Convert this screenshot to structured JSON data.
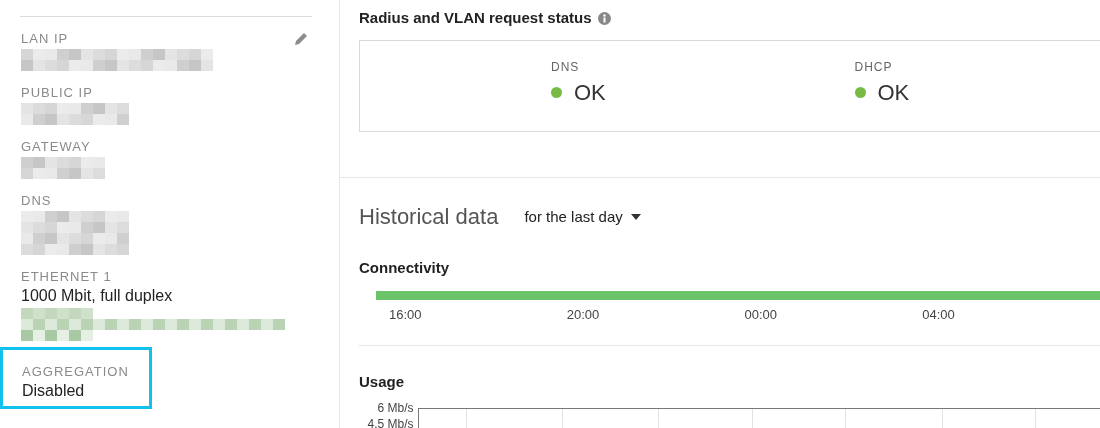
{
  "details": [
    {
      "label": "LAN IP",
      "editable": true
    },
    {
      "label": "PUBLIC IP"
    },
    {
      "label": "GATEWAY"
    },
    {
      "label": "DNS"
    },
    {
      "label": "ETHERNET 1",
      "value": "1000 Mbit, full duplex"
    },
    {
      "label": "AGGREGATION",
      "value": "Disabled",
      "highlighted": true
    }
  ],
  "request_status": {
    "title": "Radius and VLAN request status",
    "items": [
      {
        "label": "DNS",
        "value": "OK",
        "color": "#77bb44"
      },
      {
        "label": "DHCP",
        "value": "OK",
        "color": "#77bb44"
      }
    ]
  },
  "historical": {
    "title": "Historical data",
    "range": "for the last day",
    "connectivity": {
      "title": "Connectivity",
      "times": [
        "16:00",
        "20:00",
        "00:00",
        "04:00"
      ]
    },
    "usage": {
      "title": "Usage",
      "y_labels": [
        "6 Mb/s",
        "4.5 Mb/s"
      ]
    }
  }
}
